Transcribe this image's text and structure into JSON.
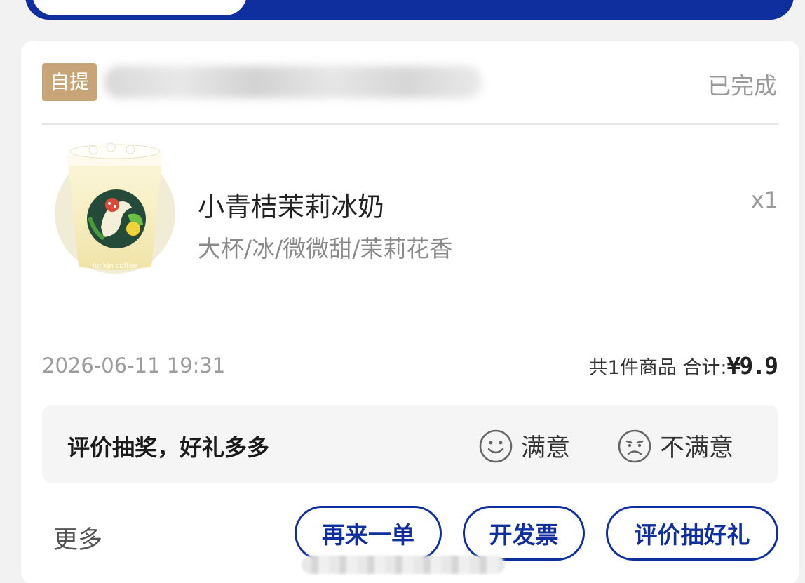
{
  "order": {
    "pickup_badge": "自提",
    "status": "已完成",
    "product": {
      "name": "小青桔茉莉冰奶",
      "specs": "大杯/冰/微微甜/茉莉花香",
      "quantity": "x1",
      "cup_brand_text": "luckin coffee"
    },
    "time": "2026-06-11 19:31",
    "summary_label": "共1件商品 合计: ",
    "total": "¥9.9"
  },
  "review": {
    "title": "评价抽奖，好礼多多",
    "satisfied": "满意",
    "unsatisfied": "不满意"
  },
  "actions": {
    "more": "更多",
    "reorder": "再来一单",
    "invoice": "开发票",
    "review_gift": "评价抽好礼"
  },
  "colors": {
    "brand_blue": "#0f2f9e",
    "badge_gold": "#c7a578",
    "background": "#f2f2f2"
  }
}
